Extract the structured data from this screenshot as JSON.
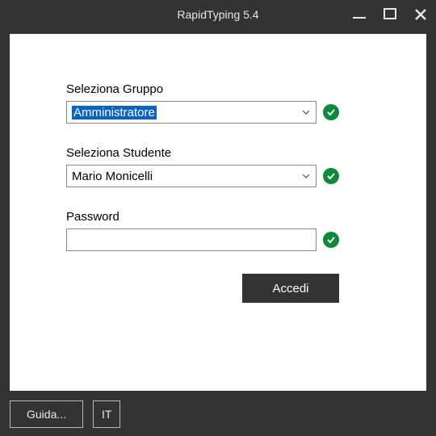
{
  "window": {
    "title": "RapidTyping 5.4"
  },
  "form": {
    "group": {
      "label": "Seleziona Gruppo",
      "value": "Amministratore"
    },
    "student": {
      "label": "Seleziona Studente",
      "value": "Mario Monicelli"
    },
    "password": {
      "label": "Password",
      "value": ""
    },
    "submit": "Accedi"
  },
  "footer": {
    "help": "Guida...",
    "lang": "IT"
  }
}
